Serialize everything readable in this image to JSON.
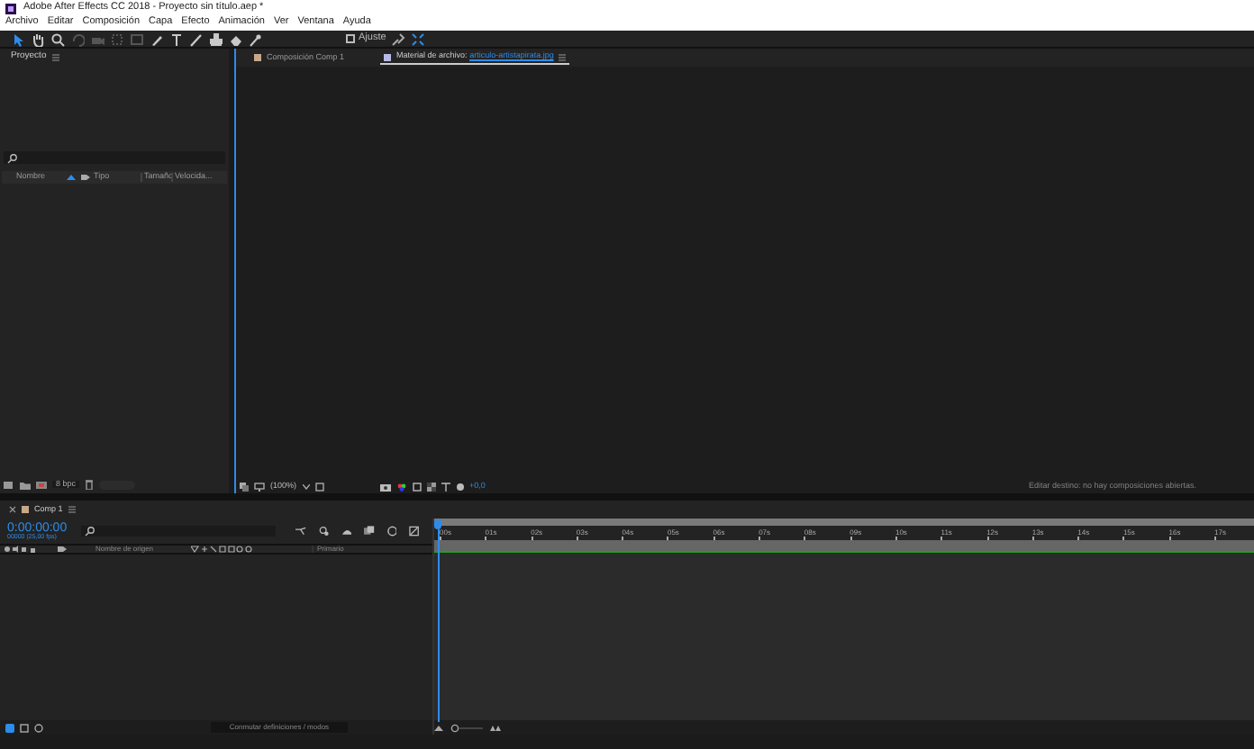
{
  "window": {
    "title": "Adobe After Effects CC 2018 - Proyecto sin título.aep *"
  },
  "menu": [
    "Archivo",
    "Editar",
    "Composición",
    "Capa",
    "Efecto",
    "Animación",
    "Ver",
    "Ventana",
    "Ayuda"
  ],
  "tools": [
    {
      "selected": true
    },
    {
      "selected": false
    },
    {
      "selected": false
    },
    {
      "selected": false
    },
    {
      "selected": false
    },
    {
      "selected": false
    },
    {
      "selected": false
    },
    {
      "selected": false
    },
    {
      "selected": false
    },
    {
      "selected": false
    },
    {
      "selected": false
    },
    {
      "selected": false
    },
    {
      "selected": false
    }
  ],
  "snap": {
    "label": "Ajuste",
    "checked": false
  },
  "project": {
    "tab": "Proyecto",
    "columns": [
      "Nombre",
      "Tipo",
      "Tamaño",
      "Velocida..."
    ],
    "bpc": "8 bpc"
  },
  "viewer": {
    "tabs": [
      {
        "label": "Composición",
        "name": "Comp 1",
        "selected": false
      },
      {
        "label": "Material de archivo:",
        "name": "articulo-artistapirata.jpg",
        "selected": true
      }
    ],
    "zoom": "(100%)",
    "exposure": "+0,0",
    "target": "Editar destino: no hay composiciones abiertas."
  },
  "timeline": {
    "tab": "Comp 1",
    "timecode": "0:00:00:00",
    "frames": "00000 (25,00 fps)",
    "columns": [
      "Nombre de origen",
      "Primario"
    ],
    "ruler": [
      "00s",
      "01s",
      "02s",
      "03s",
      "04s",
      "05s",
      "06s",
      "07s",
      "08s",
      "09s",
      "10s",
      "11s",
      "12s",
      "13s",
      "14s",
      "15s",
      "16s",
      "17s"
    ],
    "toggle": "Conmutar definiciones / modos"
  }
}
